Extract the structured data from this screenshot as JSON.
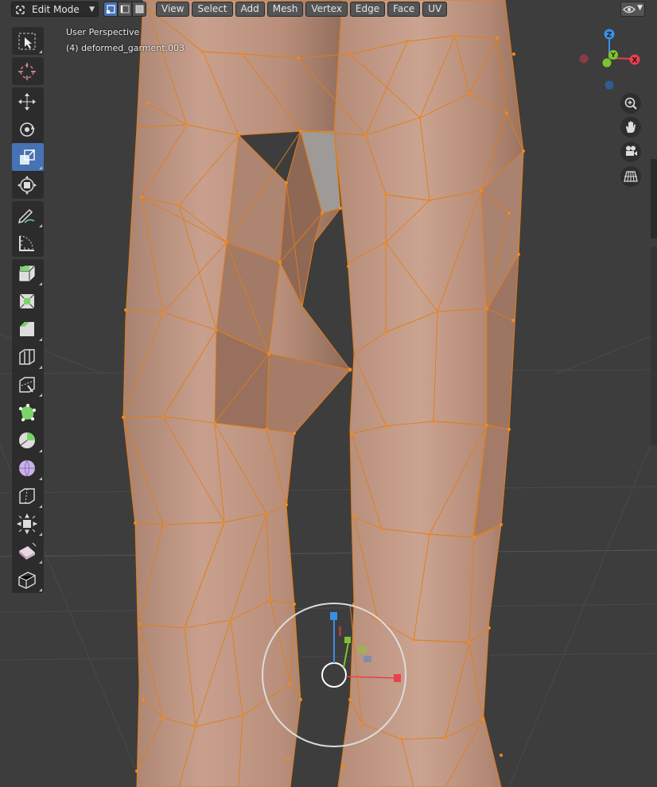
{
  "header": {
    "mode": {
      "label": "Edit Mode",
      "icon": "edit-mode-icon"
    },
    "select_modes": [
      {
        "name": "vertex-select-mode",
        "active": true
      },
      {
        "name": "edge-select-mode",
        "active": false
      },
      {
        "name": "face-select-mode",
        "active": false
      }
    ],
    "menus": [
      "View",
      "Select",
      "Add",
      "Mesh",
      "Vertex",
      "Edge",
      "Face",
      "UV"
    ],
    "visibility_icon": "eye-icon"
  },
  "viewport": {
    "perspective_label": "User Perspective",
    "object_label": "(4) deformed_garment.003"
  },
  "toolbar": {
    "groups": [
      [
        "select-box-tool"
      ],
      [
        "cursor-tool"
      ],
      [
        "move-tool",
        "rotate-tool",
        "scale-tool",
        "transform-tool"
      ],
      [
        "annotate-tool",
        "measure-tool"
      ],
      [
        "extrude-region-tool",
        "inset-faces-tool",
        "bevel-tool",
        "loop-cut-tool",
        "knife-tool",
        "poly-build-tool",
        "spin-tool",
        "smooth-tool",
        "edge-slide-tool",
        "shrink-fatten-tool",
        "shear-tool",
        "rip-region-tool"
      ]
    ],
    "active": "scale-tool"
  },
  "gizmo": {
    "axes": {
      "x": "X",
      "y": "Y",
      "z": "Z"
    },
    "colors": {
      "x": "#e8404f",
      "y": "#7ec42e",
      "z": "#3d8fe2",
      "neg_x": "#8c3a44",
      "neg_z": "#2f5e93"
    }
  },
  "nav_buttons": [
    "zoom-icon",
    "pan-hand-icon",
    "camera-icon",
    "ortho-grid-icon"
  ],
  "colors": {
    "background": "#3d3d3d",
    "mesh_fill": "#b78f7c",
    "mesh_edge": "#e07d1a",
    "active_tool": "#4772b3"
  }
}
